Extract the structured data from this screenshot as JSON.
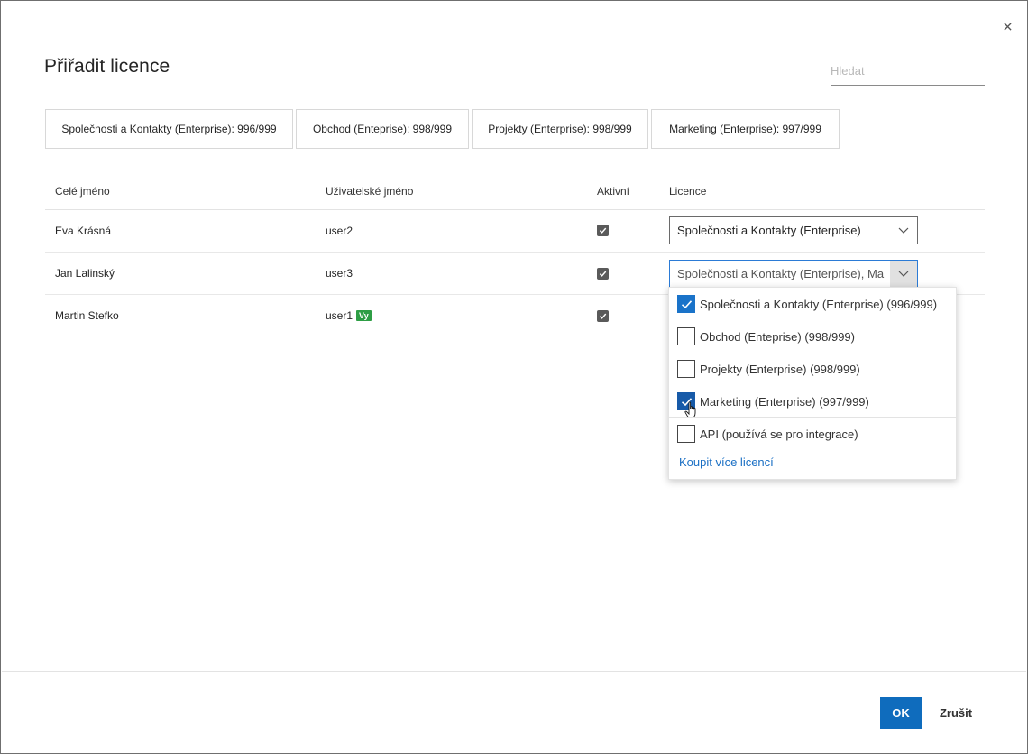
{
  "dialog": {
    "title": "Přiřadit licence",
    "close_icon": "close-icon",
    "search_placeholder": "Hledat"
  },
  "license_tiles": [
    {
      "label": "Společnosti a Kontakty (Enterprise): 996/999"
    },
    {
      "label": "Obchod (Enteprise): 998/999"
    },
    {
      "label": "Projekty (Enterprise): 998/999"
    },
    {
      "label": "Marketing (Enterprise): 997/999"
    }
  ],
  "table": {
    "headers": {
      "full_name": "Celé jméno",
      "username": "Uživatelské jméno",
      "active": "Aktivní",
      "license": "Licence"
    },
    "rows": [
      {
        "full_name": "Eva Krásná",
        "username": "user2",
        "badge": "",
        "active": true,
        "license": "Společnosti a Kontakty (Enterprise)"
      },
      {
        "full_name": "Jan Lalinský",
        "username": "user3",
        "badge": "",
        "active": true,
        "license": "Společnosti a Kontakty (Enterprise), Ma"
      },
      {
        "full_name": "Martin Stefko",
        "username": "user1",
        "badge": "Vy",
        "active": true,
        "license": ""
      }
    ]
  },
  "license_dropdown": {
    "options": [
      {
        "label": "Společnosti a Kontakty (Enterprise) (996/999)",
        "checked": true
      },
      {
        "label": "Obchod (Enteprise) (998/999)",
        "checked": false
      },
      {
        "label": "Projekty (Enterprise) (998/999)",
        "checked": false
      },
      {
        "label": "Marketing (Enterprise) (997/999)",
        "checked": true
      },
      {
        "label": "API (používá se pro integrace)",
        "checked": false
      }
    ],
    "buy_link": "Koupit více licencí"
  },
  "footer": {
    "ok_label": "OK",
    "cancel_label": "Zrušit"
  },
  "colors": {
    "primary": "#0f6cbd",
    "checkbox_checked": "#1a73c9",
    "badge_green": "#2e9e45",
    "link": "#1a6fc4"
  }
}
